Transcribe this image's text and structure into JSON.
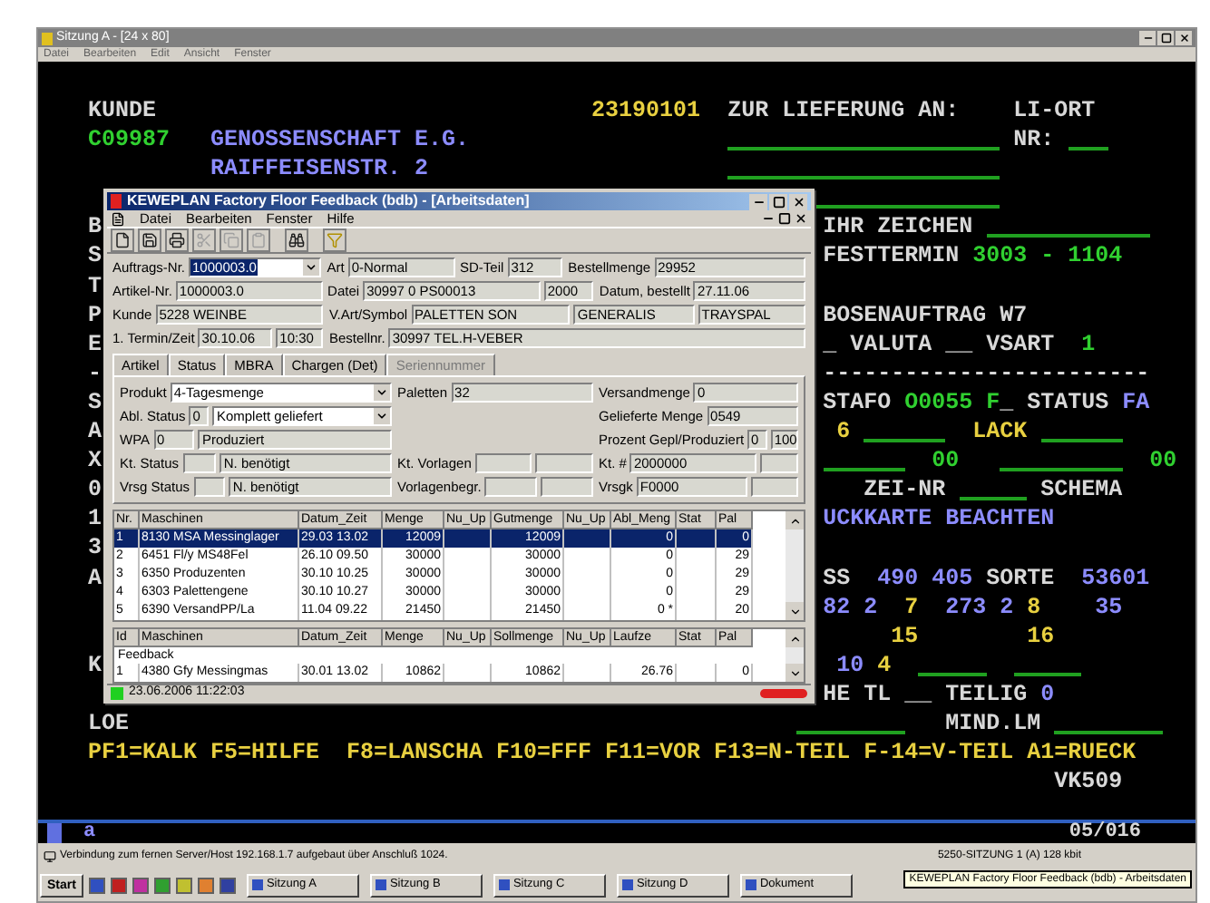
{
  "terminal_window": {
    "title": "Sitzung A - [24 x 80]",
    "menu": [
      "Datei",
      "Bearbeiten",
      "Edit",
      "Ansicht",
      "Fenster"
    ]
  },
  "terminal": {
    "rows": [
      {
        "segments": [
          {
            "text": "KUNDE",
            "color": "#d8d8d8"
          },
          {
            "text": "23190101",
            "color": "#e8d040"
          },
          {
            "text": "ZUR LIEFERUNG AN:",
            "color": "#d8d8d8"
          },
          {
            "text": "LI-ORT",
            "color": "#d8d8d8"
          }
        ]
      },
      {
        "segments": [
          {
            "text": "C09987",
            "color": "#30d030"
          },
          {
            "text": "GENOSSENSCHAFT E.G.",
            "color": "#8c8cff"
          },
          {
            "text": "NR:",
            "color": "#d8d8d8"
          }
        ]
      },
      {
        "segments": [
          {
            "text": "RAIFFEISENSTR. 2",
            "color": "#8c8cff"
          }
        ]
      },
      {
        "segments": []
      },
      {
        "segments": [
          {
            "text": "B",
            "color": "#d8d8d8"
          },
          {
            "text": "IHR ZEICHEN",
            "color": "#d8d8d8"
          }
        ]
      },
      {
        "segments": [
          {
            "text": "S",
            "color": "#d8d8d8"
          },
          {
            "text": "FESTTERMIN",
            "color": "#d8d8d8"
          },
          {
            "text": "3003 - 1104",
            "color": "#30d030"
          }
        ]
      },
      {
        "segments": [
          {
            "text": "T",
            "color": "#d8d8d8"
          }
        ]
      },
      {
        "segments": [
          {
            "text": "P",
            "color": "#d8d8d8"
          },
          {
            "text": "BOSENAUFTRAG W7",
            "color": "#d8d8d8"
          }
        ]
      },
      {
        "segments": [
          {
            "text": "E",
            "color": "#d8d8d8"
          },
          {
            "text": "_ VALUTA __ VSART",
            "color": "#d8d8d8"
          },
          {
            "text": "1",
            "color": "#30d030"
          }
        ]
      },
      {
        "segments": [
          {
            "text": "-",
            "color": "#d8d8d8"
          },
          {
            "text": "------------------------",
            "color": "#d8d8d8"
          }
        ]
      },
      {
        "segments": [
          {
            "text": "S",
            "color": "#d8d8d8"
          },
          {
            "text": "STAFO",
            "color": "#d8d8d8"
          },
          {
            "text": "O0055 F",
            "color": "#30d030"
          },
          {
            "text": "_ STATUS",
            "color": "#d8d8d8"
          },
          {
            "text": "FA",
            "color": "#8c8cff"
          }
        ]
      },
      {
        "segments": [
          {
            "text": "A",
            "color": "#d8d8d8"
          },
          {
            "text": "6",
            "color": "#e8d040"
          },
          {
            "text": "LACK",
            "color": "#e8d040"
          }
        ]
      },
      {
        "segments": [
          {
            "text": "X",
            "color": "#d8d8d8"
          },
          {
            "text": "00",
            "color": "#30d030"
          },
          {
            "text": "00",
            "color": "#30d030"
          }
        ]
      },
      {
        "segments": [
          {
            "text": "0",
            "color": "#d8d8d8"
          },
          {
            "text": "ZEI-NR",
            "color": "#d8d8d8"
          },
          {
            "text": "SCHEMA",
            "color": "#d8d8d8"
          }
        ]
      },
      {
        "segments": [
          {
            "text": "1",
            "color": "#d8d8d8"
          },
          {
            "text": "UCKKARTE BEACHTEN",
            "color": "#8c8cff"
          }
        ]
      },
      {
        "segments": [
          {
            "text": "3",
            "color": "#d8d8d8"
          }
        ]
      },
      {
        "segments": [
          {
            "text": "A",
            "color": "#d8d8d8"
          },
          {
            "text": "SS",
            "color": "#d8d8d8"
          },
          {
            "text": "490",
            "color": "#8c8cff"
          },
          {
            "text": "405",
            "color": "#8c8cff"
          },
          {
            "text": "SORTE",
            "color": "#d8d8d8"
          },
          {
            "text": "53601",
            "color": "#8c8cff"
          }
        ]
      },
      {
        "segments": [
          {
            "text": "82 2",
            "color": "#8c8cff"
          },
          {
            "text": "7",
            "color": "#e8d040"
          },
          {
            "text": "273 2",
            "color": "#8c8cff"
          },
          {
            "text": "8",
            "color": "#e8d040"
          },
          {
            "text": "35",
            "color": "#8c8cff"
          }
        ]
      },
      {
        "segments": [
          {
            "text": "15",
            "color": "#e8d040"
          },
          {
            "text": "16",
            "color": "#e8d040"
          }
        ]
      },
      {
        "segments": [
          {
            "text": "K",
            "color": "#d8d8d8"
          },
          {
            "text": "10",
            "color": "#8c8cff"
          },
          {
            "text": "4",
            "color": "#e8d040"
          }
        ]
      },
      {
        "segments": [
          {
            "text": "HE TL __",
            "color": "#d8d8d8"
          },
          {
            "text": "TEILIG",
            "color": "#d8d8d8"
          },
          {
            "text": "0",
            "color": "#8c8cff"
          }
        ]
      },
      {
        "segments": [
          {
            "text": "LOE",
            "color": "#d8d8d8"
          },
          {
            "text": "MIND.LM",
            "color": "#d8d8d8"
          }
        ]
      },
      {
        "segments": [
          {
            "text": "PF1=KALK F5=HILFE  F8=LANSCHA F10=FFF F11=VOR F13=N-TEIL F-14=V-TEIL A1=RUECK",
            "color": "#e8d040"
          }
        ]
      },
      {
        "segments": [
          {
            "text": "VK509",
            "color": "#d8d8d8"
          }
        ]
      }
    ],
    "status_line": {
      "left": "a",
      "right": "05/016"
    }
  },
  "dialog": {
    "title": "KEWEPLAN Factory Floor Feedback (bdb) - [Arbeitsdaten]",
    "menu": [
      "Datei",
      "Bearbeiten",
      "Fenster",
      "Hilfe"
    ],
    "form": [
      [
        {
          "label": "Auftrags-Nr.",
          "fields": [
            {
              "value": "1000003.0",
              "kind": "combo",
              "highlighted": true
            }
          ]
        },
        {
          "label": "Art",
          "fields": [
            {
              "value": "0-Normal",
              "kind": "text"
            }
          ]
        },
        {
          "label": "SD-Teil",
          "fields": [
            {
              "value": "312",
              "kind": "text"
            }
          ]
        },
        {
          "label": "Bestellmenge",
          "fields": [
            {
              "value": "29952",
              "kind": "text"
            }
          ]
        }
      ],
      [
        {
          "label": "Artikel-Nr.",
          "fields": [
            {
              "value": "1000003.0",
              "kind": "text"
            }
          ]
        },
        {
          "label": "Datei",
          "fields": [
            {
              "value": "30997 0 PS00013",
              "kind": "text"
            },
            {
              "value": "2000",
              "kind": "text"
            }
          ]
        },
        {
          "label": "Datum, bestellt",
          "fields": [
            {
              "value": "27.11.06",
              "kind": "text"
            }
          ]
        }
      ],
      [
        {
          "label": "Kunde",
          "fields": [
            {
              "value": "5228 WEINBE",
              "kind": "text"
            }
          ]
        },
        {
          "label": "V.Art/Symbol",
          "fields": [
            {
              "value": "PALETTEN SON",
              "kind": "text"
            },
            {
              "value": "GENERALIS",
              "kind": "text"
            },
            {
              "value": "TRAYSPAL",
              "kind": "text"
            }
          ]
        }
      ],
      [
        {
          "label": "1. Termin/Zeit",
          "fields": [
            {
              "value": "30.10.06",
              "kind": "text"
            },
            {
              "value": "10:30",
              "kind": "text"
            }
          ]
        },
        {
          "label": "Bestellnr.",
          "fields": [
            {
              "value": "30997 TEL.H-VEBER",
              "kind": "text"
            }
          ]
        }
      ]
    ],
    "tabs": [
      {
        "label": "Artikel",
        "selected": false,
        "disabled": false
      },
      {
        "label": "Status",
        "selected": true,
        "disabled": false
      },
      {
        "label": "MBRA",
        "selected": false,
        "disabled": false
      },
      {
        "label": "Chargen (Det)",
        "selected": false,
        "disabled": false
      },
      {
        "label": "Seriennummer",
        "selected": false,
        "disabled": true
      }
    ],
    "panel": [
      [
        {
          "label": "Produkt",
          "fields": [
            {
              "value": "4-Tagesmenge",
              "kind": "combo"
            }
          ]
        },
        {
          "label": "Paletten",
          "fields": [
            {
              "value": "32",
              "kind": "text"
            }
          ]
        },
        {
          "label": "Versandmenge",
          "fields": [
            {
              "value": "0",
              "kind": "text"
            }
          ]
        }
      ],
      [
        {
          "label": "Abl. Status",
          "fields": [
            {
              "value": "0",
              "kind": "text"
            },
            {
              "value": "Komplett geliefert",
              "kind": "combo"
            }
          ]
        },
        {
          "label": "Gelieferte Menge",
          "fields": [
            {
              "value": "0549",
              "kind": "text"
            }
          ]
        }
      ],
      [
        {
          "label": "WPA",
          "fields": [
            {
              "value": "0",
              "kind": "text"
            },
            {
              "value": "Produziert",
              "kind": "text"
            }
          ]
        },
        {
          "label": "Prozent Gepl/Produziert",
          "fields": [
            {
              "value": "0",
              "kind": "text"
            },
            {
              "value": "100",
              "kind": "text"
            }
          ]
        }
      ],
      [
        {
          "label": "Kt. Status",
          "fields": [
            {
              "kind": "text"
            },
            {
              "value": "N. benötigt",
              "kind": "text"
            }
          ]
        },
        {
          "label": "Kt. Vorlagen",
          "fields": [
            {
              "kind": "text"
            },
            {
              "kind": "text"
            }
          ]
        },
        {
          "label": "Kt. #",
          "fields": [
            {
              "value": "2000000",
              "kind": "text"
            },
            {
              "kind": "text"
            }
          ]
        }
      ],
      [
        {
          "label": "Vrsg Status",
          "fields": [
            {
              "kind": "text"
            },
            {
              "value": "N. benötigt",
              "kind": "text"
            }
          ]
        },
        {
          "label": "Vorlagenbegr.",
          "fields": [
            {
              "kind": "text"
            },
            {
              "kind": "text"
            }
          ]
        },
        {
          "label": "Vrsgk",
          "fields": [
            {
              "value": "F0000",
              "kind": "text"
            },
            {
              "kind": "text"
            }
          ]
        }
      ]
    ],
    "table": {
      "columns": [
        "Nr.",
        "Maschinen",
        "Datum_Zeit",
        "Menge",
        "Nu_Up",
        "Gutmenge",
        "Nu_Up",
        "Abl_Meng",
        "Stat",
        "Pal"
      ],
      "rows": [
        {
          "selected": true,
          "cells": [
            "1",
            "8130 MSA Messinglager",
            "29.03 13.02",
            "12009",
            "",
            "12009",
            "",
            "0",
            "",
            "0"
          ]
        },
        {
          "selected": false,
          "cells": [
            "2",
            "6451 Fl/y MS48Fel",
            "26.10 09.50",
            "30000",
            "",
            "30000",
            "",
            "0",
            "",
            "29"
          ]
        },
        {
          "selected": false,
          "cells": [
            "3",
            "6350 Produzenten",
            "30.10 10.25",
            "30000",
            "",
            "30000",
            "",
            "0",
            "",
            "29"
          ]
        },
        {
          "selected": false,
          "cells": [
            "4",
            "6303 Palettengene",
            "30.10 10.27",
            "30000",
            "",
            "30000",
            "",
            "0",
            "",
            "29"
          ]
        },
        {
          "selected": false,
          "cells": [
            "5",
            "6390 VersandPP/La",
            "11.04 09.22",
            "21450",
            "",
            "21450",
            "",
            "0 *",
            "",
            "20"
          ]
        }
      ]
    },
    "feedback_table": {
      "columns": [
        "Id",
        "Maschinen",
        "Datum_Zeit",
        "Menge",
        "Nu_Up",
        "Sollmenge",
        "Nu_Up",
        "Laufze",
        "Stat",
        "Pal"
      ],
      "group": "Feedback",
      "rows": [
        {
          "cells": [
            "1",
            "4380 Gfy Messingmas",
            "30.01 13.02",
            "10862",
            "",
            "10862",
            "",
            "26.76",
            "",
            "0"
          ]
        }
      ]
    },
    "status": {
      "text": "23.06.2006 11:22:03"
    }
  },
  "status_bar": {
    "left": "Verbindung zum fernen Server/Host 192.168.1.7 aufgebaut über Anschluß 1024.",
    "right": "5250-SITZUNG 1 (A) 128 kbit"
  },
  "taskbar": {
    "start": "Start",
    "buttons": [
      "Sitzung A",
      "Sitzung B",
      "Sitzung C",
      "Sitzung D",
      "Dokument"
    ],
    "tooltip": "KEWEPLAN Factory Floor Feedback (bdb) - Arbeitsdaten"
  }
}
